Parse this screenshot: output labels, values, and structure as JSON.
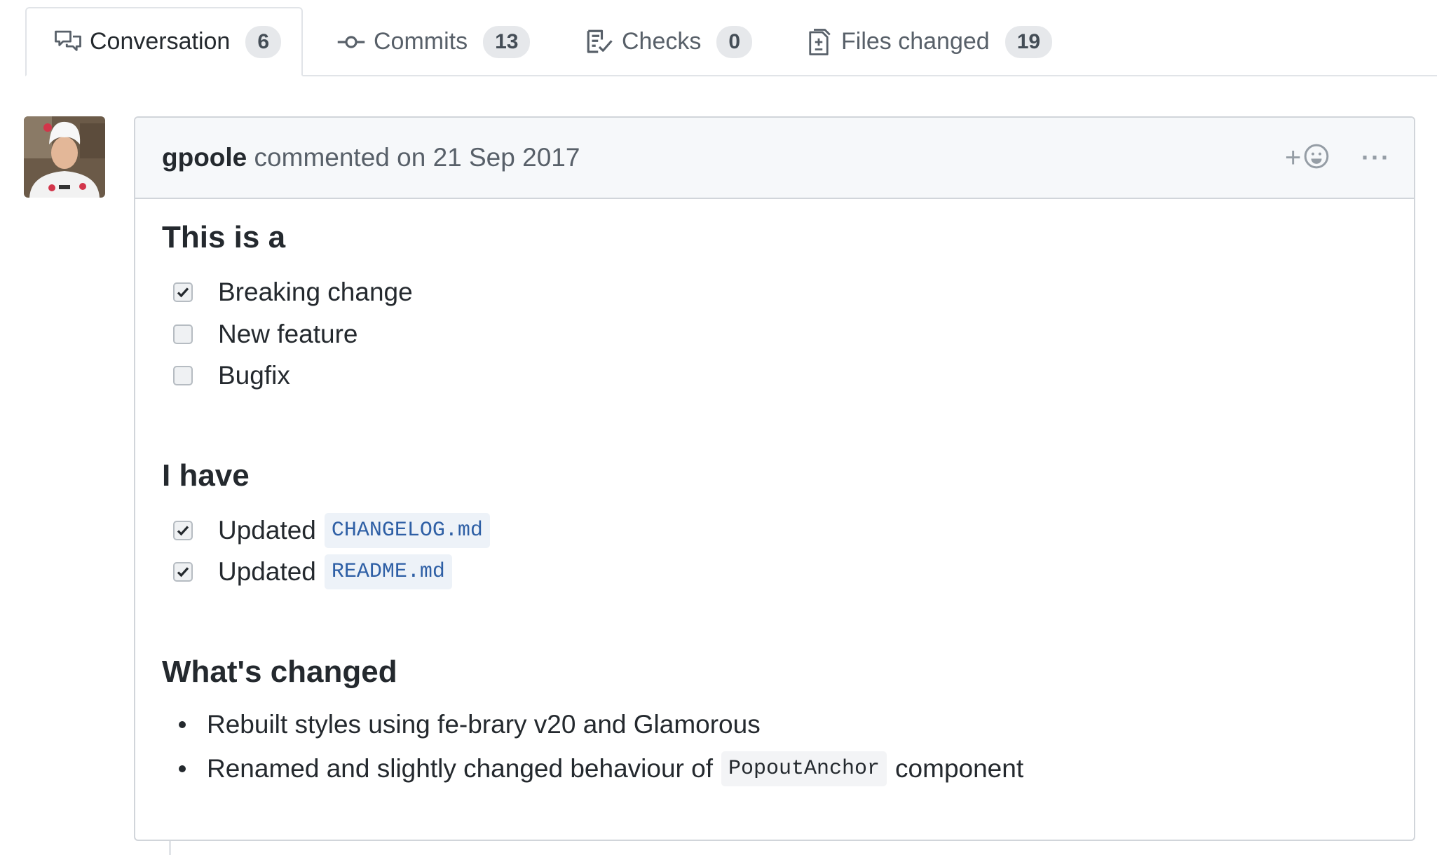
{
  "tabs": [
    {
      "label": "Conversation",
      "count": "6",
      "icon": "comment-discussion-icon",
      "selected": true
    },
    {
      "label": "Commits",
      "count": "13",
      "icon": "git-commit-icon",
      "selected": false
    },
    {
      "label": "Checks",
      "count": "0",
      "icon": "checklist-icon",
      "selected": false
    },
    {
      "label": "Files changed",
      "count": "19",
      "icon": "diff-icon",
      "selected": false
    }
  ],
  "comment": {
    "author": "gpoole",
    "action": " commented on 21 Sep 2017",
    "add_reaction_label": "+",
    "more_label": "···",
    "sections": {
      "type_heading": "This is a",
      "type_items": [
        {
          "label": "Breaking change",
          "checked": true
        },
        {
          "label": "New feature",
          "checked": false
        },
        {
          "label": "Bugfix",
          "checked": false
        }
      ],
      "have_heading": "I have",
      "have_items": [
        {
          "label": "Updated",
          "code": "CHANGELOG.md",
          "checked": true
        },
        {
          "label": "Updated",
          "code": "README.md",
          "checked": true
        }
      ],
      "changed_heading": "What's changed",
      "changed_items": [
        {
          "text": "Rebuilt styles using fe-brary v20 and Glamorous"
        },
        {
          "before": "Renamed and slightly changed behaviour of",
          "code": "PopoutAnchor",
          "after": "component"
        }
      ]
    }
  },
  "colors": {
    "text": "#24292e",
    "muted": "#586069",
    "border": "#d1d5da",
    "header_bg": "#f6f8fa",
    "code_link": "#2e5fa5",
    "counter_bg": "#e6e8eb"
  }
}
